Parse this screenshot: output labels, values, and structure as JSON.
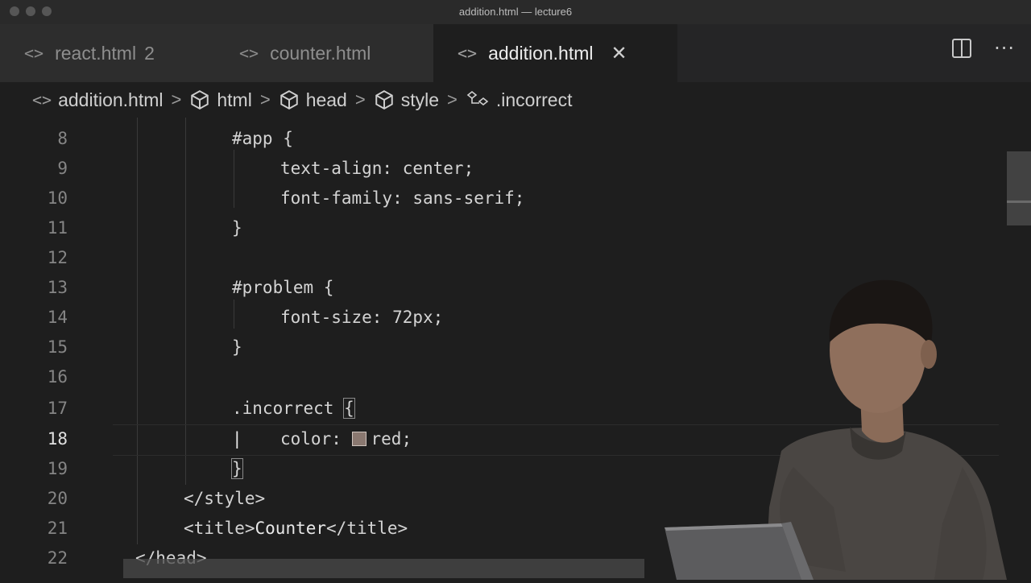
{
  "window": {
    "title": "addition.html — lecture6"
  },
  "tabs": [
    {
      "label": "react.html",
      "badge": "2",
      "active": false
    },
    {
      "label": "counter.html",
      "active": false
    },
    {
      "label": "addition.html",
      "active": true
    }
  ],
  "tab_icon_glyph": "<>",
  "tab_close_glyph": "✕",
  "breadcrumb": [
    {
      "label": "addition.html",
      "icon": "file-code-icon"
    },
    {
      "label": "html",
      "icon": "cube-icon"
    },
    {
      "label": "head",
      "icon": "cube-icon"
    },
    {
      "label": "style",
      "icon": "cube-icon"
    },
    {
      "label": ".incorrect",
      "icon": "class-symbol-icon"
    }
  ],
  "breadcrumb_separator": ">",
  "editor": {
    "current_line": 18,
    "lines": [
      {
        "n": "8",
        "segments": [
          "#app {"
        ]
      },
      {
        "n": "9",
        "segments": [
          "text-align: center;"
        ]
      },
      {
        "n": "10",
        "segments": [
          "font-family: sans-serif;"
        ]
      },
      {
        "n": "11",
        "segments": [
          "}"
        ]
      },
      {
        "n": "12",
        "segments": [
          ""
        ]
      },
      {
        "n": "13",
        "segments": [
          "#problem {"
        ]
      },
      {
        "n": "14",
        "segments": [
          "font-size: 72px;"
        ]
      },
      {
        "n": "15",
        "segments": [
          "}"
        ]
      },
      {
        "n": "16",
        "segments": [
          ""
        ]
      },
      {
        "n": "17",
        "segments": [
          ".incorrect ",
          "{"
        ]
      },
      {
        "n": "18",
        "segments": [
          "color: ",
          "red;"
        ]
      },
      {
        "n": "19",
        "segments": [
          "}"
        ]
      },
      {
        "n": "20",
        "segments": [
          "</style>"
        ]
      },
      {
        "n": "21",
        "segments": [
          "<title>",
          "Counter",
          "</title>"
        ]
      },
      {
        "n": "22",
        "segments": [
          "</head>"
        ]
      }
    ],
    "color_swatch": "#8a7870"
  },
  "colors": {
    "editor_bg": "#1e1e1e",
    "tabbar_bg": "#252526",
    "active_tab_text": "#ececec",
    "inactive_tab_text": "#8e8e8e",
    "line_number": "#858585"
  }
}
